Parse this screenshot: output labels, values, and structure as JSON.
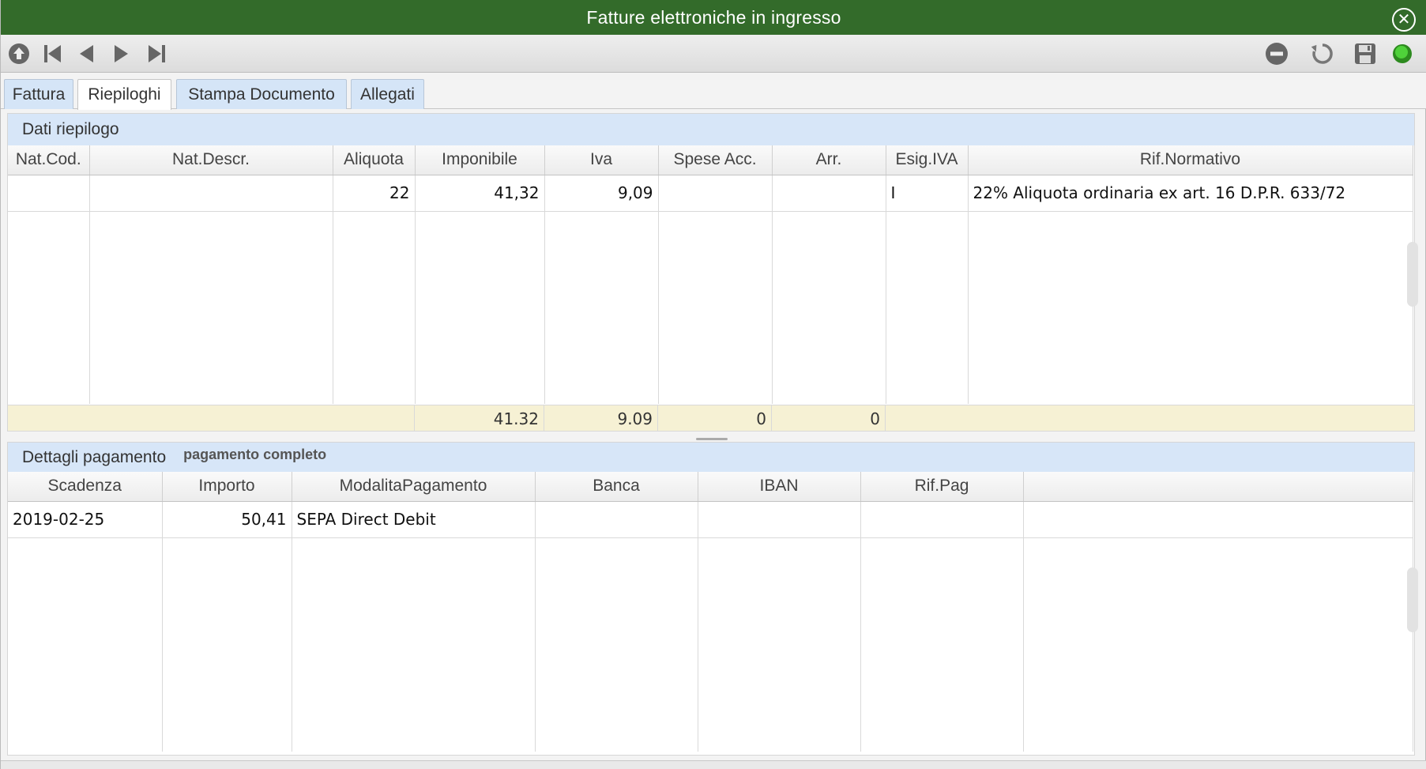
{
  "window": {
    "title": "Fatture elettroniche in ingresso"
  },
  "icons": {
    "close": "close-circle-icon",
    "up": "circle-up-icon",
    "first": "skip-first-icon",
    "prev": "prev-icon",
    "next": "next-icon",
    "last": "skip-last-icon",
    "minus": "minus-circle-icon",
    "refresh": "refresh-icon",
    "save": "save-icon",
    "status": "status-dot-icon"
  },
  "colors": {
    "titlebar": "#336b2a",
    "tab": "#d5e5f7",
    "header": "#d7e6f8",
    "totals": "#f6f1d4",
    "status_dot": "#3fbf2a"
  },
  "tabs": [
    {
      "label": "Fattura"
    },
    {
      "label": "Riepiloghi"
    },
    {
      "label": "Stampa Documento"
    },
    {
      "label": "Allegati"
    }
  ],
  "riepilogo": {
    "title": "Dati riepilogo",
    "columns": [
      "Nat.Cod.",
      "Nat.Descr.",
      "Aliquota",
      "Imponibile",
      "Iva",
      "Spese Acc.",
      "Arr.",
      "Esig.IVA",
      "Rif.Normativo"
    ],
    "rows": [
      {
        "nat_cod": "",
        "nat_descr": "",
        "aliquota": "22",
        "imponibile": "41,32",
        "iva": "9,09",
        "spese": "",
        "arr": "",
        "esig": "I",
        "rif": "22% Aliquota ordinaria ex art. 16 D.P.R. 633/72"
      }
    ],
    "totals": {
      "imponibile": "41.32",
      "iva": "9.09",
      "spese": "0",
      "arr": "0"
    }
  },
  "pagamento": {
    "title": "Dettagli pagamento",
    "subtitle": "pagamento completo",
    "columns": [
      "Scadenza",
      "Importo",
      "ModalitaPagamento",
      "Banca",
      "IBAN",
      "Rif.Pag",
      ""
    ],
    "rows": [
      {
        "scadenza": "2019-02-25",
        "importo": "50,41",
        "modalita": "SEPA Direct Debit",
        "banca": "",
        "iban": "",
        "rifpag": "",
        "extra": ""
      }
    ]
  }
}
